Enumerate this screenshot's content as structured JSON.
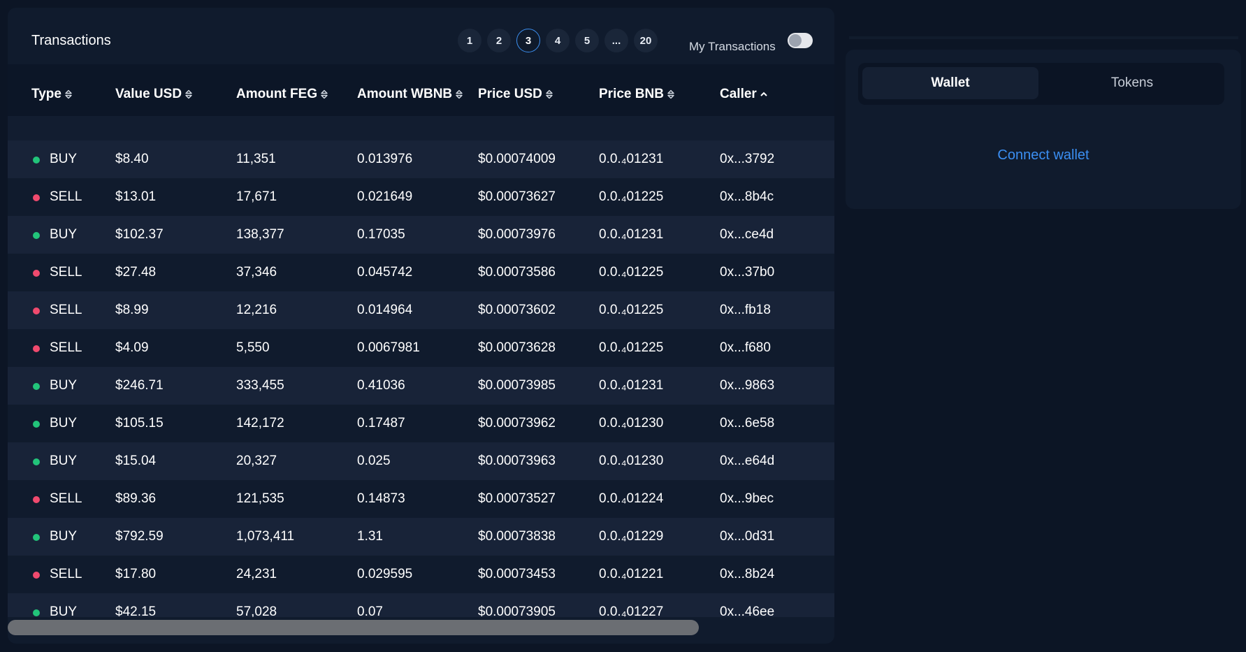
{
  "transactions": {
    "title": "Transactions",
    "pages": [
      "1",
      "2",
      "3",
      "4",
      "5",
      "...",
      "20"
    ],
    "active_page": "3",
    "my_transactions_label": "My Transactions",
    "my_transactions_enabled": false,
    "columns": [
      {
        "label": "Type",
        "sort": "both"
      },
      {
        "label": "Value USD",
        "sort": "both"
      },
      {
        "label": "Amount FEG",
        "sort": "both"
      },
      {
        "label": "Amount WBNB",
        "sort": "both"
      },
      {
        "label": "Price USD",
        "sort": "both"
      },
      {
        "label": "Price BNB",
        "sort": "both"
      },
      {
        "label": "Caller",
        "sort": "up"
      }
    ],
    "rows": [
      {
        "type": "BUY",
        "value_usd": "$8.40",
        "amount_feg": "11,351",
        "amount_wbnb": "0.013976",
        "price_usd": "$0.00074009",
        "price_bnb": "0.0.₄01231",
        "caller": "0x...3792"
      },
      {
        "type": "SELL",
        "value_usd": "$13.01",
        "amount_feg": "17,671",
        "amount_wbnb": "0.021649",
        "price_usd": "$0.00073627",
        "price_bnb": "0.0.₄01225",
        "caller": "0x...8b4c"
      },
      {
        "type": "BUY",
        "value_usd": "$102.37",
        "amount_feg": "138,377",
        "amount_wbnb": "0.17035",
        "price_usd": "$0.00073976",
        "price_bnb": "0.0.₄01231",
        "caller": "0x...ce4d"
      },
      {
        "type": "SELL",
        "value_usd": "$27.48",
        "amount_feg": "37,346",
        "amount_wbnb": "0.045742",
        "price_usd": "$0.00073586",
        "price_bnb": "0.0.₄01225",
        "caller": "0x...37b0"
      },
      {
        "type": "SELL",
        "value_usd": "$8.99",
        "amount_feg": "12,216",
        "amount_wbnb": "0.014964",
        "price_usd": "$0.00073602",
        "price_bnb": "0.0.₄01225",
        "caller": "0x...fb18"
      },
      {
        "type": "SELL",
        "value_usd": "$4.09",
        "amount_feg": "5,550",
        "amount_wbnb": "0.0067981",
        "price_usd": "$0.00073628",
        "price_bnb": "0.0.₄01225",
        "caller": "0x...f680"
      },
      {
        "type": "BUY",
        "value_usd": "$246.71",
        "amount_feg": "333,455",
        "amount_wbnb": "0.41036",
        "price_usd": "$0.00073985",
        "price_bnb": "0.0.₄01231",
        "caller": "0x...9863"
      },
      {
        "type": "BUY",
        "value_usd": "$105.15",
        "amount_feg": "142,172",
        "amount_wbnb": "0.17487",
        "price_usd": "$0.00073962",
        "price_bnb": "0.0.₄01230",
        "caller": "0x...6e58"
      },
      {
        "type": "BUY",
        "value_usd": "$15.04",
        "amount_feg": "20,327",
        "amount_wbnb": "0.025",
        "price_usd": "$0.00073963",
        "price_bnb": "0.0.₄01230",
        "caller": "0x...e64d"
      },
      {
        "type": "SELL",
        "value_usd": "$89.36",
        "amount_feg": "121,535",
        "amount_wbnb": "0.14873",
        "price_usd": "$0.00073527",
        "price_bnb": "0.0.₄01224",
        "caller": "0x...9bec"
      },
      {
        "type": "BUY",
        "value_usd": "$792.59",
        "amount_feg": "1,073,411",
        "amount_wbnb": "1.31",
        "price_usd": "$0.00073838",
        "price_bnb": "0.0.₄01229",
        "caller": "0x...0d31"
      },
      {
        "type": "SELL",
        "value_usd": "$17.80",
        "amount_feg": "24,231",
        "amount_wbnb": "0.029595",
        "price_usd": "$0.00073453",
        "price_bnb": "0.0.₄01221",
        "caller": "0x...8b24"
      },
      {
        "type": "BUY",
        "value_usd": "$42.15",
        "amount_feg": "57,028",
        "amount_wbnb": "0.07",
        "price_usd": "$0.00073905",
        "price_bnb": "0.0.₄01227",
        "caller": "0x...46ee"
      }
    ]
  },
  "wallet_panel": {
    "tabs": [
      {
        "label": "Wallet",
        "active": true
      },
      {
        "label": "Tokens",
        "active": false
      }
    ],
    "connect_label": "Connect wallet"
  },
  "colors": {
    "buy": "#22c47a",
    "sell": "#f04a6e",
    "accent": "#3b8ff3"
  }
}
